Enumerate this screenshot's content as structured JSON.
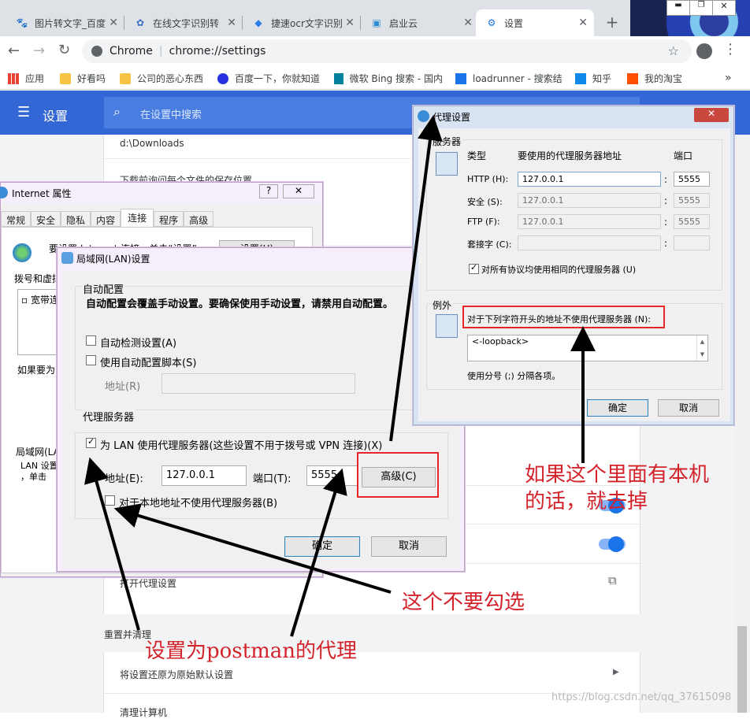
{
  "tabs": [
    {
      "title": "图片转文字_百度",
      "icon": "paw-icon"
    },
    {
      "title": "在线文字识别转",
      "icon": "gear-icon"
    },
    {
      "title": "捷速ocr文字识别",
      "icon": "shield-icon"
    },
    {
      "title": "启业云",
      "icon": "cloud-icon"
    },
    {
      "title": "设置",
      "icon": "settings-gear-icon"
    }
  ],
  "omnibox": {
    "scheme_label": "Chrome",
    "url": "chrome://settings"
  },
  "bookmarks": [
    "应用",
    "好看吗",
    "公司的恶心东西",
    "百度一下，你就知道",
    "微软 Bing 搜索 - 国内",
    "loadrunner - 搜索结",
    "知乎",
    "我的淘宝"
  ],
  "settings": {
    "title": "设置",
    "search_placeholder": "在设置中搜索",
    "download_path": "d:\\Downloads",
    "ask_location": "下载前询问每个文件的保存位置",
    "open_proxy": "打开代理设置",
    "reset_section": "重置并清理",
    "restore_defaults": "将设置还原为原始默认设置",
    "cleanup": "清理计算机"
  },
  "internet_props": {
    "title": "Internet 属性",
    "tabs": [
      "常规",
      "安全",
      "隐私",
      "内容",
      "连接",
      "程序",
      "高级"
    ],
    "active_tab": "连接",
    "setup_text": "要设置 Internet 连接，单击“设置”。",
    "setup_button": "设置(U)",
    "dialup_label": "拨号和虚拟",
    "broadband": "宽带连",
    "if_proxy": "如果要为",
    "lan_label": "局域网(LA",
    "lan_desc1": "LAN 设置",
    "lan_desc2": "，单击"
  },
  "lan_dialog": {
    "title": "局域网(LAN)设置",
    "auto_config_title": "自动配置",
    "auto_config_desc": "自动配置会覆盖手动设置。要确保使用手动设置，请禁用自动配置。",
    "auto_detect": "自动检测设置(A)",
    "auto_script": "使用自动配置脚本(S)",
    "address_label": "地址(R)",
    "proxy_title": "代理服务器",
    "use_proxy": "为 LAN 使用代理服务器(这些设置不用于拨号或 VPN 连接)(X)",
    "addr_label": "地址(E):",
    "addr_value": "127.0.0.1",
    "port_label": "端口(T):",
    "port_value": "5555",
    "advanced": "高级(C)",
    "bypass_local": "对于本地地址不使用代理服务器(B)",
    "ok": "确定",
    "cancel": "取消"
  },
  "proxy_dialog": {
    "title": "代理设置",
    "servers": "服务器",
    "col_type": "类型",
    "col_address": "要使用的代理服务器地址",
    "col_port": "端口",
    "rows": [
      {
        "type": "HTTP (H):",
        "address": "127.0.0.1",
        "port": "5555"
      },
      {
        "type": "安全 (S):",
        "address": "127.0.0.1",
        "port": "5555"
      },
      {
        "type": "FTP (F):",
        "address": "127.0.0.1",
        "port": "5555"
      },
      {
        "type": "套接字 (C):",
        "address": "",
        "port": ""
      }
    ],
    "same_proxy": "对所有协议均使用相同的代理服务器 (U)",
    "exceptions": "例外",
    "no_proxy_prefix": "对于下列字符开头的地址不使用代理服务器 (N):",
    "exception_value": "<-loopback>",
    "semicolon_hint": "使用分号 (;) 分隔各项。",
    "ok": "确定",
    "cancel": "取消"
  },
  "annotations": {
    "remove_local": "如果这个里面有本机\n的话，就去掉",
    "dont_check": "这个不要勾选",
    "set_postman": "设置为postman的代理"
  },
  "watermark": "https://blog.csdn.net/qq_37615098",
  "colors": {
    "chrome_blue": "#3367d6",
    "annotation_red": "#d3242c",
    "toggle_blue": "#1a73e8"
  }
}
